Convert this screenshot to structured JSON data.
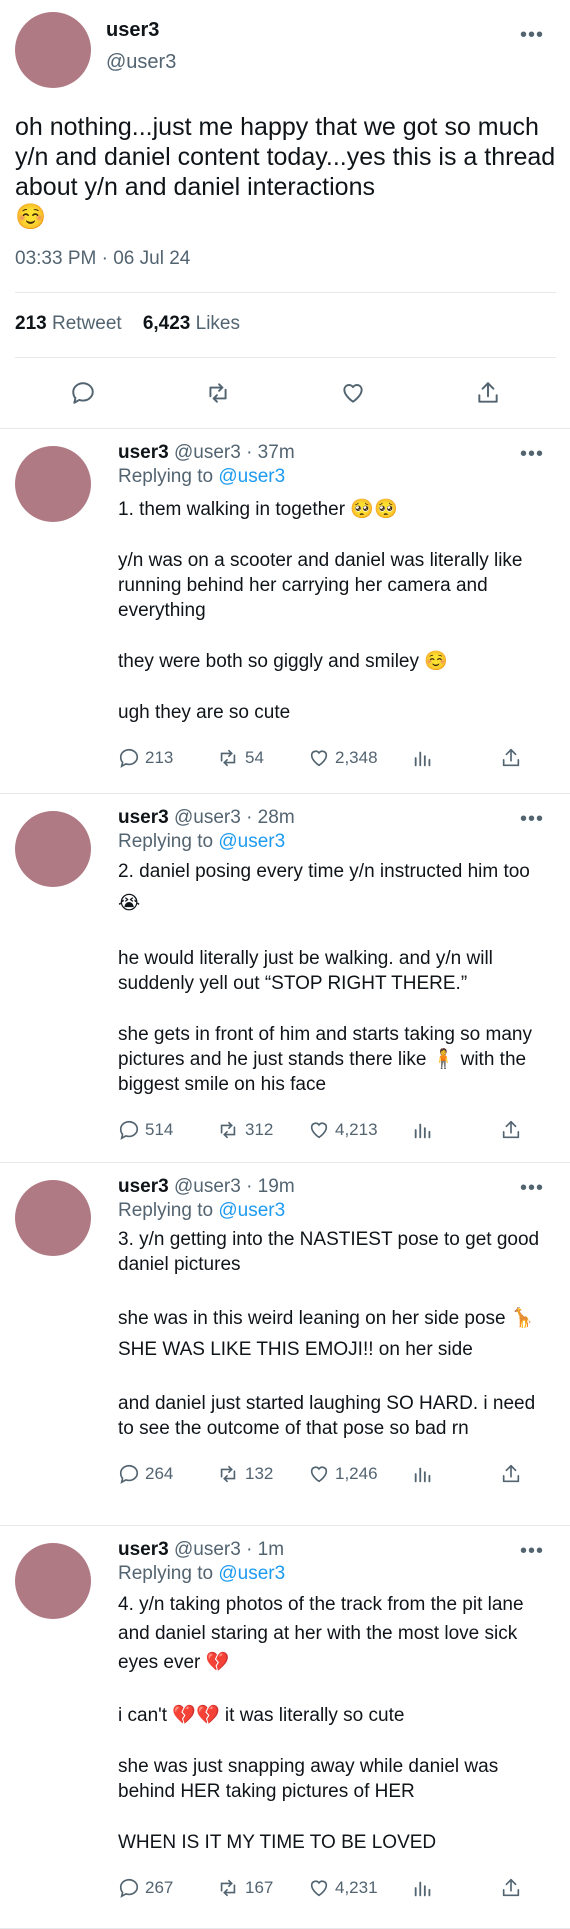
{
  "main_tweet": {
    "display_name": "user3",
    "handle": "@user3",
    "text": "oh nothing...just me happy that we got so much y/n and daniel content today...yes this is a thread about y/n and daniel interactions",
    "emoji": "☺️",
    "timestamp": "03:33 PM · 06 Jul 24",
    "retweet_count": "213",
    "retweet_label": "Retweet",
    "likes_count": "6,423",
    "likes_label": "Likes"
  },
  "replies": [
    {
      "display_name": "user3",
      "handle_time": "@user3 · 37m",
      "replying_label": "Replying to",
      "replying_to": "@user3",
      "lines": [
        "1. them walking in together 🥺🥺",
        "",
        "y/n was on a scooter and daniel was literally like running behind her carrying her camera and everything",
        "",
        "they were both so giggly and smiley ☺️",
        "",
        "ugh they are so cute"
      ],
      "replies": "213",
      "retweets": "54",
      "likes": "2,348"
    },
    {
      "display_name": "user3",
      "handle_time": "@user3 · 28m",
      "replying_label": "Replying to",
      "replying_to": "@user3",
      "lines": [
        "2. daniel posing every time y/n instructed him too 😭",
        "",
        "he would literally just be walking. and y/n will suddenly yell out “STOP RIGHT THERE.”",
        "",
        "she gets in front of him and starts taking so many pictures and he just stands there like 🧍 with the biggest smile on his face"
      ],
      "replies": "514",
      "retweets": "312",
      "likes": "4,213"
    },
    {
      "display_name": "user3",
      "handle_time": "@user3 · 19m",
      "replying_label": "Replying to",
      "replying_to": "@user3",
      "lines": [
        "3. y/n getting into the NASTIEST pose to get good daniel pictures",
        "",
        "she was in this weird leaning on her side pose 🦒 SHE WAS LIKE THIS EMOJI!! on her side",
        "",
        "and daniel just started laughing SO HARD. i need to see the outcome of that pose so bad rn"
      ],
      "replies": "264",
      "retweets": "132",
      "likes": "1,246"
    },
    {
      "display_name": "user3",
      "handle_time": "@user3 · 1m",
      "replying_label": "Replying to",
      "replying_to": "@user3",
      "lines": [
        "4. y/n taking photos of the track from the pit lane and daniel staring at her with the most love sick eyes ever 💔",
        "",
        "i can't 💔💔 it was literally so cute",
        "",
        "she was just snapping away while daniel was behind HER taking pictures of HER",
        "",
        "WHEN IS IT MY TIME TO BE LOVED"
      ],
      "replies": "267",
      "retweets": "167",
      "likes": "4,231"
    }
  ],
  "icons": {
    "more": "more-horizontal-icon",
    "reply": "reply-icon",
    "retweet": "retweet-icon",
    "like": "heart-icon",
    "analytics": "analytics-icon",
    "share": "share-icon"
  },
  "colors": {
    "accent": "#1d9bf0",
    "avatar": "#b07a85",
    "muted": "#536471"
  }
}
